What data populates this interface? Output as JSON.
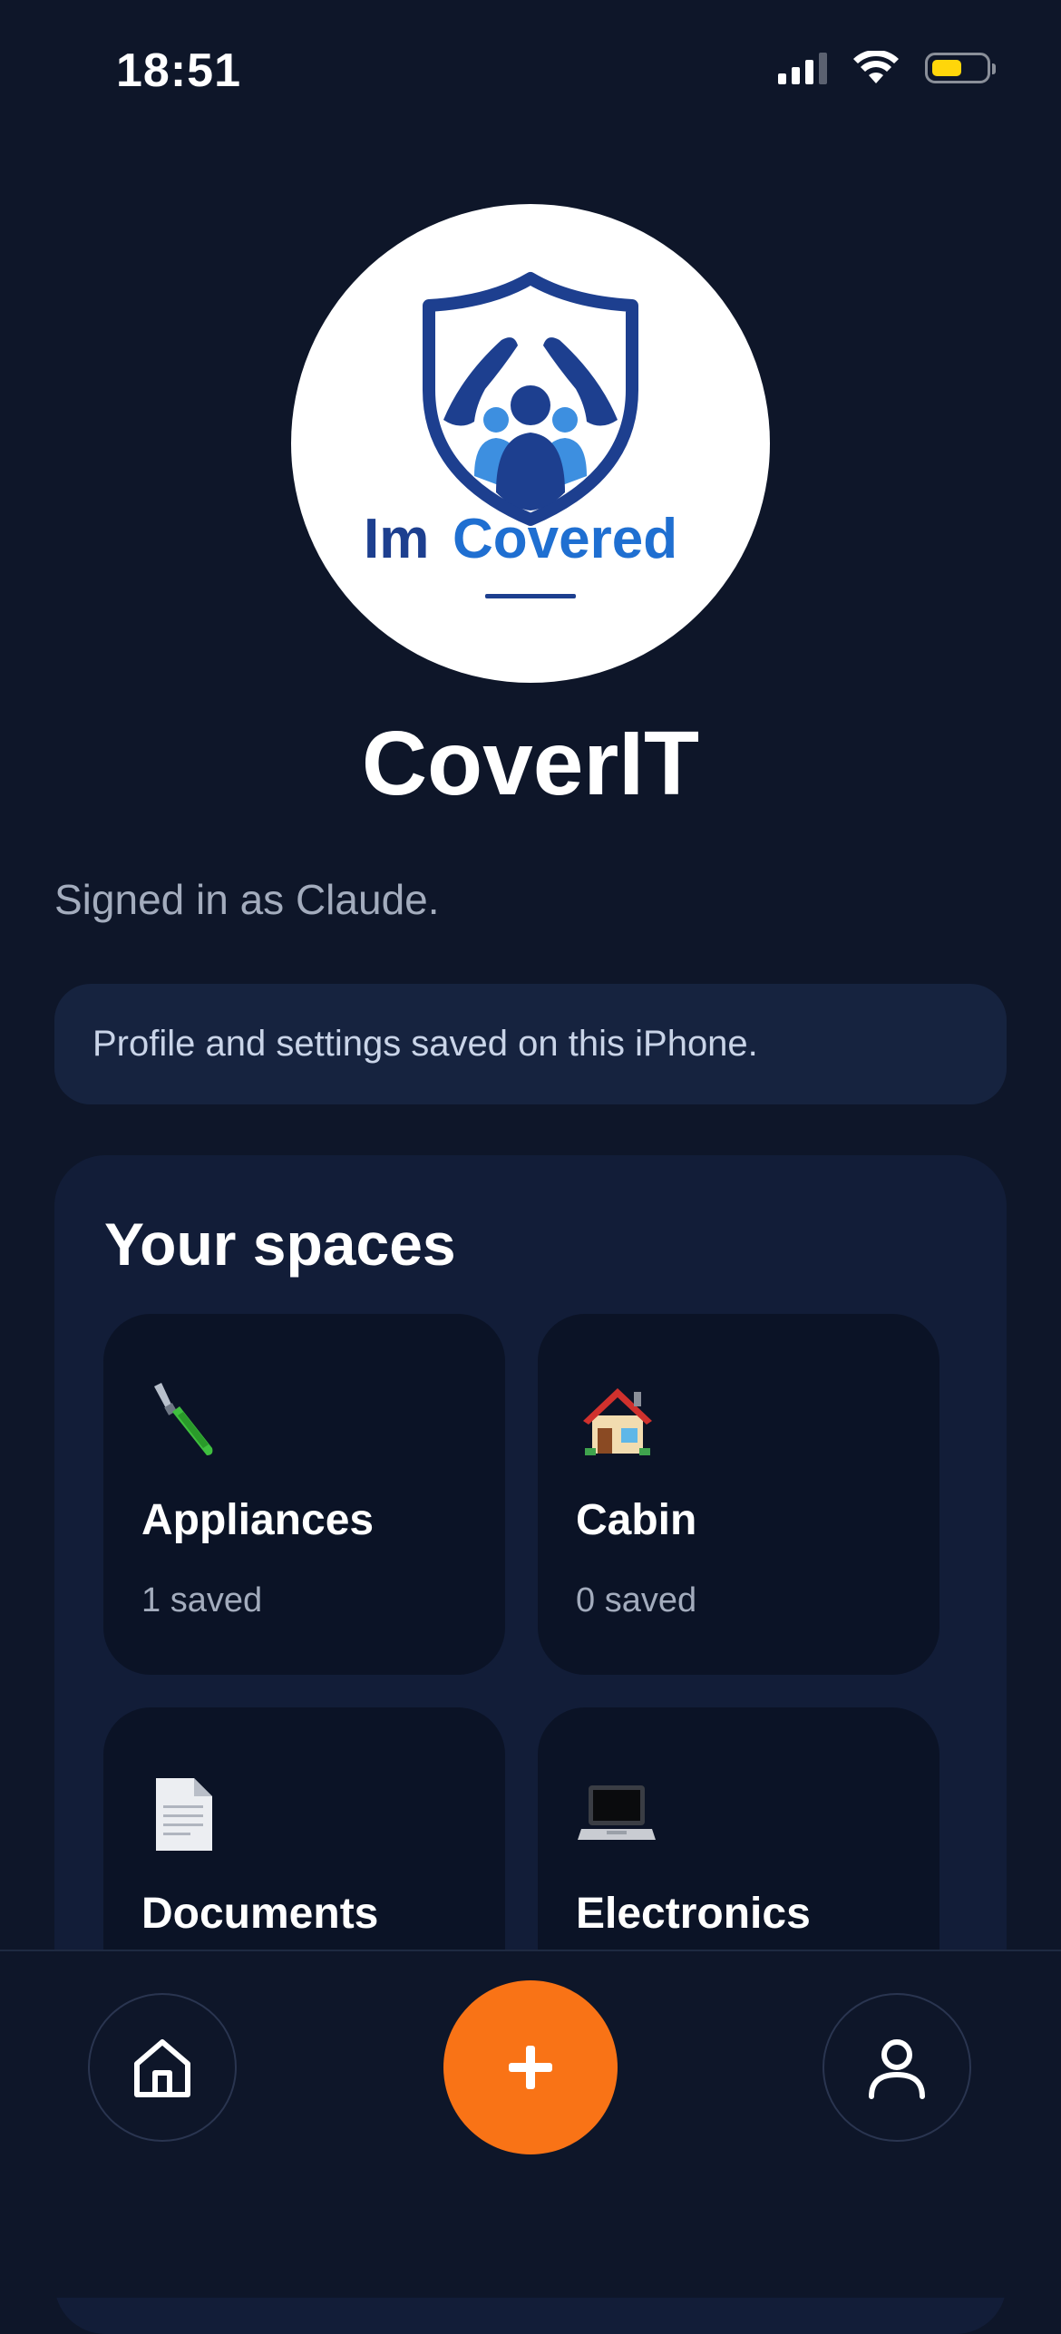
{
  "status_bar": {
    "time": "18:51",
    "icons": [
      "cellular-signal-icon",
      "wifi-icon",
      "battery-icon"
    ],
    "battery_level": 0.45,
    "battery_color": "#ffd60a"
  },
  "logo": {
    "wordmark_part1": "Im",
    "wordmark_part2": "Covered",
    "colors": {
      "navy": "#1d3f8f",
      "blue": "#1f6fd1",
      "light_blue": "#3d8fe0"
    }
  },
  "app": {
    "title": "CoverIT",
    "signed_in_text": "Signed in as Claude.",
    "notice": "Profile and settings saved on this iPhone."
  },
  "spaces": {
    "title": "Your spaces",
    "items": [
      {
        "name": "Appliances",
        "count": "1 saved",
        "icon": "screwdriver-icon"
      },
      {
        "name": "Cabin",
        "count": "0 saved",
        "icon": "house-icon"
      },
      {
        "name": "Documents",
        "count": "",
        "icon": "document-icon"
      },
      {
        "name": "Electronics",
        "count": "",
        "icon": "laptop-icon"
      }
    ]
  },
  "bottom_nav": {
    "items": [
      "home-icon",
      "add-icon",
      "profile-icon"
    ],
    "accent_color": "#f97316"
  }
}
